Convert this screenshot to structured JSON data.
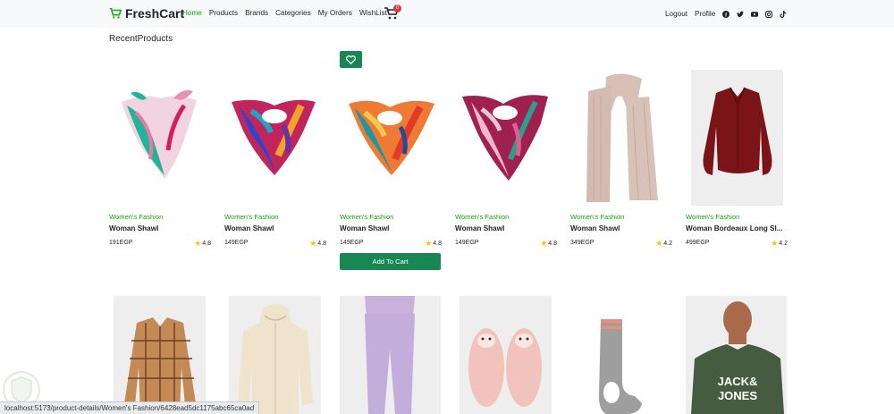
{
  "navbar": {
    "brand": "FreshCart",
    "links": [
      "Home",
      "Products",
      "Brands",
      "Categories",
      "My Orders",
      "WishList"
    ],
    "cart_count": "0",
    "right_links": [
      "Logout",
      "Profile"
    ],
    "social_icons": [
      "facebook-icon",
      "twitter-icon",
      "youtube-icon",
      "instagram-icon",
      "tiktok-icon"
    ]
  },
  "section_title": "RecentProducts",
  "products": [
    {
      "category": "Women's Fashion",
      "title": "Woman Shawl",
      "price": "191EGP",
      "rating": "4.8"
    },
    {
      "category": "Women's Fashion",
      "title": "Woman Shawl",
      "price": "149EGP",
      "rating": "4.8"
    },
    {
      "category": "Women's Fashion",
      "title": "Woman Shawl",
      "price": "149EGP",
      "rating": "4.8"
    },
    {
      "category": "Women's Fashion",
      "title": "Woman Shawl",
      "price": "149EGP",
      "rating": "4.8"
    },
    {
      "category": "Women's Fashion",
      "title": "Woman Shawl",
      "price": "349EGP",
      "rating": "4.2"
    },
    {
      "category": "Women's Fashion",
      "title": "Woman Bordeaux Long Sl...",
      "price": "499EGP",
      "rating": "4.2"
    }
  ],
  "add_to_cart_label": "Add To Cart",
  "status_url": "localhost:5173/product-details/Women's Fashion/6428ead5dc1175abc65ca0ad",
  "colors": {
    "accent": "#0aad0a",
    "button": "#198754",
    "badge": "#dc3545"
  }
}
